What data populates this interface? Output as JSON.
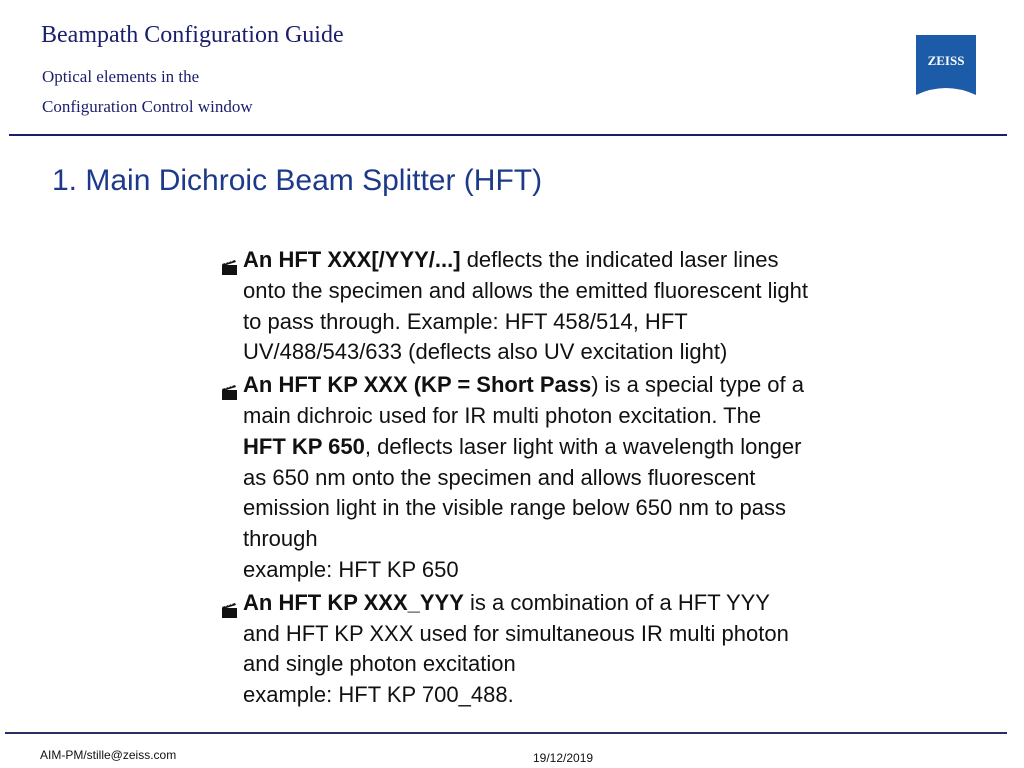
{
  "header": {
    "title": "Beampath Configuration Guide",
    "subtitle_line1": "Optical elements in the",
    "subtitle_line2": "Configuration Control window",
    "logo_text": "ZEISS",
    "logo_icon": "zeiss-logo",
    "brand_color": "#1b5ba8"
  },
  "slide": {
    "title": "1. Main Dichroic Beam Splitter (HFT)",
    "bullet_icon": "clapperboard-icon",
    "bullets": [
      {
        "bold": "An HFT XXX[/YYY/...]",
        "text_after_bold": " deflects the indicated laser lines\nonto the specimen and allows the emitted fluorescent light\nto pass through. Example: HFT 458/514, HFT\nUV/488/543/633 (deflects also UV excitation light)"
      },
      {
        "bold": "An HFT KP XXX (KP = Short Pass",
        "text_after_bold": ") is a special type of a\nmain dichroic used for IR multi photon excitation. The\n",
        "bold2": "HFT KP 650",
        "text_after_bold2": ", deflects laser light with a wavelength longer\nas 650 nm onto the specimen and allows fluorescent\nemission light in the visible range below 650 nm to pass\nthrough\nexample: HFT KP 650"
      },
      {
        "bold": "An HFT KP XXX_YYY",
        "text_after_bold": " is a combination of a HFT YYY\nand HFT KP XXX used for simultaneous IR multi photon\nand single photon excitation\nexample: HFT KP 700_488."
      }
    ]
  },
  "footer": {
    "author": "AIM-PM/stille@zeiss.com",
    "date": "19/12/2019"
  }
}
